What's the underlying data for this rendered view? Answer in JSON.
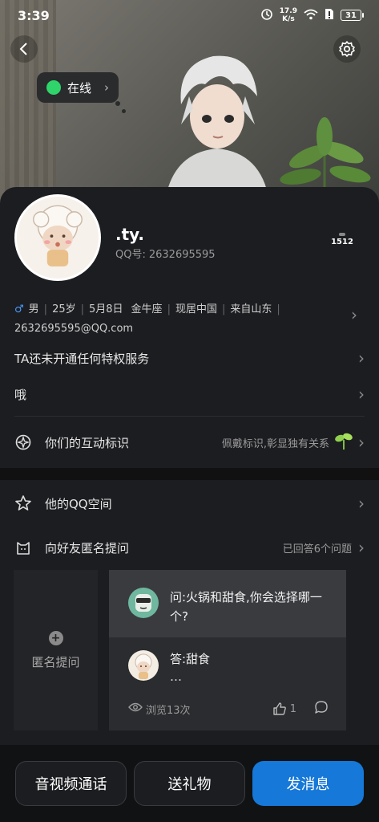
{
  "status_bar": {
    "time": "3:39",
    "net_speed": "17.9",
    "net_unit": "K/s",
    "battery": "31"
  },
  "presence": {
    "label": "在线"
  },
  "profile": {
    "nickname": ".ty.",
    "qq_label": "QQ号:",
    "qq_number": "2632695595",
    "level_value": "1512"
  },
  "info": {
    "gender": "男",
    "age": "25岁",
    "birthday": "5月8日",
    "zodiac": "金牛座",
    "location": "现居中国",
    "hometown": "来自山东",
    "email": "2632695595@QQ.com"
  },
  "privilege": {
    "label": "TA还未开通任何特权服务"
  },
  "signature": {
    "text": "哦"
  },
  "interaction": {
    "label": "你们的互动标识",
    "hint": "佩戴标识,彰显独有关系"
  },
  "qzone": {
    "label": "他的QQ空间"
  },
  "anon": {
    "label": "向好友匿名提问",
    "hint": "已回答6个问题"
  },
  "qa": {
    "ask_label": "匿名提问",
    "question": "问:火锅和甜食,你会选择哪一个?",
    "answer": "答:甜食",
    "answer_more": "…",
    "views": "浏览13次",
    "likes": "1"
  },
  "actions": {
    "call": "音视频通话",
    "gift": "送礼物",
    "message": "发消息"
  },
  "colors": {
    "online": "#2fd46b",
    "primary": "#1678d8",
    "male": "#4b9bff"
  }
}
